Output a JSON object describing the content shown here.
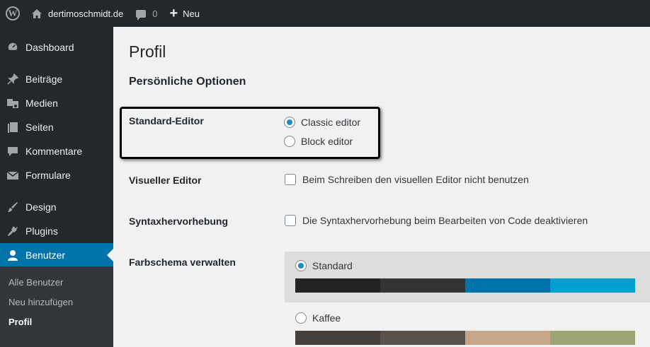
{
  "adminbar": {
    "logo_glyph": "W",
    "site_name": "dertimoschmidt.de",
    "comments_count": "0",
    "new_label": "Neu"
  },
  "sidebar": {
    "items": [
      {
        "label": "Dashboard",
        "icon": "dashboard-icon"
      },
      {
        "label": "Beiträge",
        "icon": "pin-icon"
      },
      {
        "label": "Medien",
        "icon": "media-icon"
      },
      {
        "label": "Seiten",
        "icon": "pages-icon"
      },
      {
        "label": "Kommentare",
        "icon": "comment-icon"
      },
      {
        "label": "Formulare",
        "icon": "mail-icon"
      },
      {
        "label": "Design",
        "icon": "brush-icon"
      },
      {
        "label": "Plugins",
        "icon": "plugin-icon"
      },
      {
        "label": "Benutzer",
        "icon": "user-icon"
      }
    ],
    "submenu": [
      "Alle Benutzer",
      "Neu hinzufügen",
      "Profil"
    ],
    "active_color": "#0073aa"
  },
  "main": {
    "title": "Profil",
    "section_title": "Persönliche Optionen",
    "editor": {
      "label": "Standard-Editor",
      "options": [
        "Classic editor",
        "Block editor"
      ],
      "selected": "Classic editor"
    },
    "visual_editor": {
      "label": "Visueller Editor",
      "option": "Beim Schreiben den visuellen Editor nicht benutzen",
      "checked": false
    },
    "syntax": {
      "label": "Syntaxhervorhebung",
      "option": "Die Syntaxhervorhebung beim Bearbeiten von Code deaktivieren",
      "checked": false
    },
    "color_scheme": {
      "label": "Farbschema verwalten",
      "schemes": [
        {
          "name": "Standard",
          "selected": true,
          "colors": [
            "#222222",
            "#333333",
            "#0073aa",
            "#00a0d2"
          ]
        },
        {
          "name": "Kaffee",
          "selected": false,
          "colors": [
            "#46403c",
            "#59524c",
            "#c7a589",
            "#9ea476"
          ]
        }
      ]
    }
  }
}
